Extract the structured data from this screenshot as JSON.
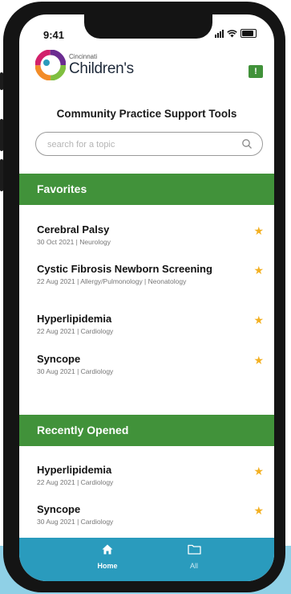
{
  "status": {
    "time": "9:41"
  },
  "header": {
    "brand_top": "Cincinnati",
    "brand_name": "Children's"
  },
  "page_title": "Community Practice Support Tools",
  "search": {
    "placeholder": "search for a topic",
    "value": ""
  },
  "favorites": {
    "heading": "Favorites",
    "items": [
      {
        "title": "Cerebral Palsy",
        "subtitle": "30 Oct 2021 | Neurology"
      },
      {
        "title": "Cystic Fibrosis Newborn Screening",
        "subtitle": "22 Aug 2021 | Allergy/Pulmonology | Neonatology"
      },
      {
        "title": "Hyperlipidemia",
        "subtitle": "22 Aug 2021 | Cardiology"
      },
      {
        "title": "Syncope",
        "subtitle": "30 Aug 2021 | Cardiology"
      }
    ]
  },
  "recent": {
    "heading": "Recently Opened",
    "items": [
      {
        "title": "Hyperlipidemia",
        "subtitle": "22 Aug 2021 | Cardiology"
      },
      {
        "title": "Syncope",
        "subtitle": "30 Aug 2021 | Cardiology"
      }
    ]
  },
  "tabs": [
    {
      "label": "Home",
      "icon": "home-icon",
      "active": true
    },
    {
      "label": "All",
      "icon": "folder-icon",
      "active": false
    }
  ],
  "colors": {
    "accent_green": "#41923a",
    "tabbar_blue": "#2a9bbd",
    "star_gold": "#f3b021",
    "background_blue": "#8fd0e6"
  }
}
